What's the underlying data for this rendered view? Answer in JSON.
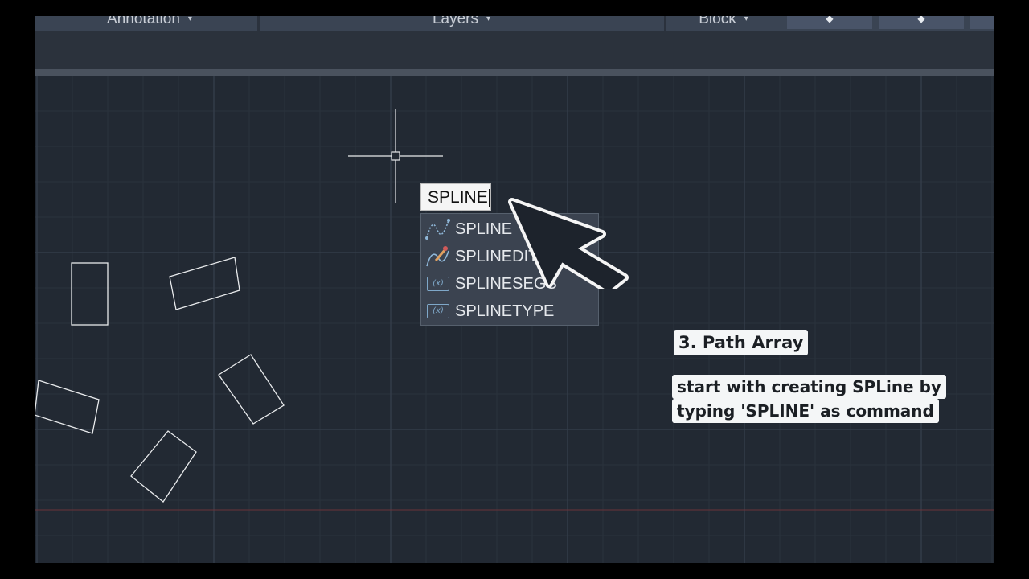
{
  "ribbon": {
    "panels": [
      {
        "label": "Annotation",
        "caret": "▾"
      },
      {
        "label": "Layers",
        "caret": "▾"
      },
      {
        "label": "Block",
        "caret": "▾"
      }
    ],
    "extra_buttons": [
      "◆",
      "◆"
    ]
  },
  "command_input": {
    "value": "SPLINE"
  },
  "autocomplete": {
    "items": [
      {
        "label": "SPLINE",
        "icon": "spline-icon"
      },
      {
        "label": "SPLINEDIT",
        "icon": "splinedit-icon"
      },
      {
        "label": "SPLINESEGS",
        "icon": "system-variable-icon"
      },
      {
        "label": "SPLINETYPE",
        "icon": "system-variable-icon"
      }
    ]
  },
  "annotations": {
    "heading": "3. Path Array",
    "line1": "start with creating SPLine by",
    "line2": "typing 'SPLINE' as command"
  },
  "colors": {
    "canvas": "#222933",
    "grid_major": "#333c49",
    "grid_minor": "#2a323d",
    "geometry": "#e8eaec",
    "x_axis_line": "#7a3a3a",
    "callout_bg": "#f4f6f7"
  }
}
